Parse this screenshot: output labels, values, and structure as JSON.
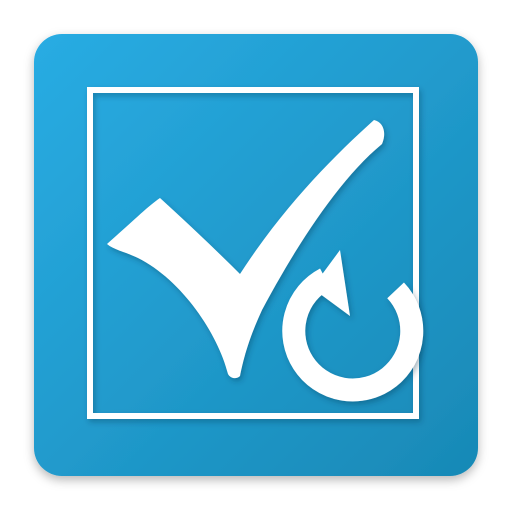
{
  "icon": {
    "semantic": "checkbox-with-refresh-app-icon",
    "colors": {
      "tile_light": "#29ACE3",
      "tile_dark": "#1889B6",
      "glyph": "#FFFFFF",
      "page_background": "#FFFFFF"
    },
    "parts": [
      "app-tile",
      "checkbox-frame",
      "checkmark-icon",
      "refresh-icon"
    ]
  }
}
